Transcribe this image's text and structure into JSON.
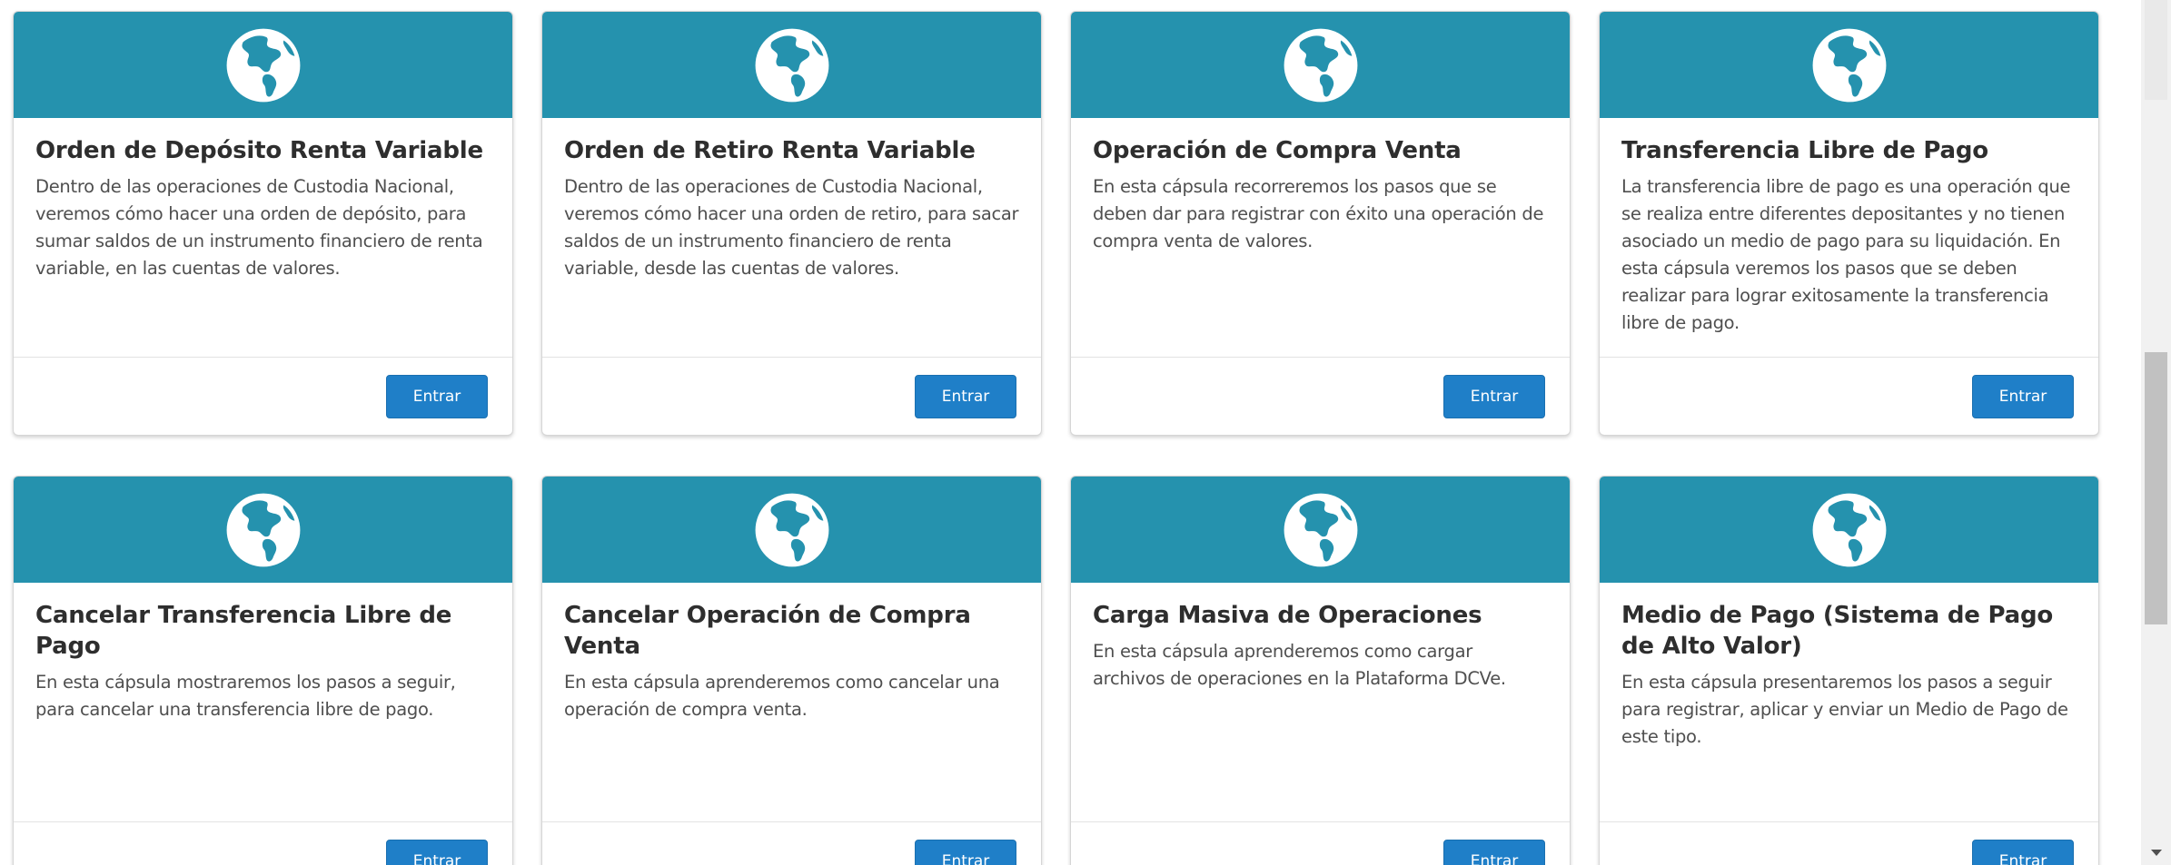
{
  "colors": {
    "header": "#2592ae",
    "button": "#1f7fc8",
    "title": "#2e2e2e",
    "description": "#4f4f4f"
  },
  "cards": [
    {
      "icon": "globe-icon",
      "title": "Orden de Depósito Renta Variable",
      "description": "Dentro de las operaciones de Custodia Nacional, veremos cómo hacer una orden de depósito, para sumar saldos de un instrumento financiero de renta variable, en las cuentas de valores.",
      "button": "Entrar"
    },
    {
      "icon": "globe-icon",
      "title": "Orden de Retiro Renta Variable",
      "description": "Dentro de las operaciones de Custodia Nacional, veremos cómo hacer una orden de retiro, para sacar saldos de un instrumento financiero de renta variable, desde las cuentas de valores.",
      "button": "Entrar"
    },
    {
      "icon": "globe-icon",
      "title": "Operación de Compra Venta",
      "description": "En esta cápsula recorreremos los pasos que se deben dar para registrar con éxito una operación de compra venta de valores.",
      "button": "Entrar"
    },
    {
      "icon": "globe-icon",
      "title": "Transferencia Libre de Pago",
      "description": "La transferencia libre de pago es una operación que se realiza entre diferentes depositantes y no tienen asociado un medio de pago para su liquidación. En esta cápsula veremos los pasos que se deben realizar para lograr exitosamente la transferencia libre de pago.",
      "button": "Entrar"
    },
    {
      "icon": "globe-icon",
      "title": "Cancelar Transferencia Libre de Pago",
      "description": "En esta cápsula mostraremos los pasos a seguir, para cancelar una transferencia libre de pago.",
      "button": "Entrar"
    },
    {
      "icon": "globe-icon",
      "title": "Cancelar Operación de Compra Venta",
      "description": "En esta cápsula aprenderemos como cancelar una operación de compra venta.",
      "button": "Entrar"
    },
    {
      "icon": "globe-icon",
      "title": "Carga Masiva de Operaciones",
      "description": "En esta cápsula aprenderemos como cargar archivos de operaciones en la Plataforma DCVe.",
      "button": "Entrar"
    },
    {
      "icon": "globe-icon",
      "title": "Medio de Pago (Sistema de Pago de Alto Valor)",
      "description": "En esta cápsula presentaremos los pasos a seguir para registrar, aplicar y enviar un Medio de Pago de este tipo.",
      "button": "Entrar"
    }
  ]
}
